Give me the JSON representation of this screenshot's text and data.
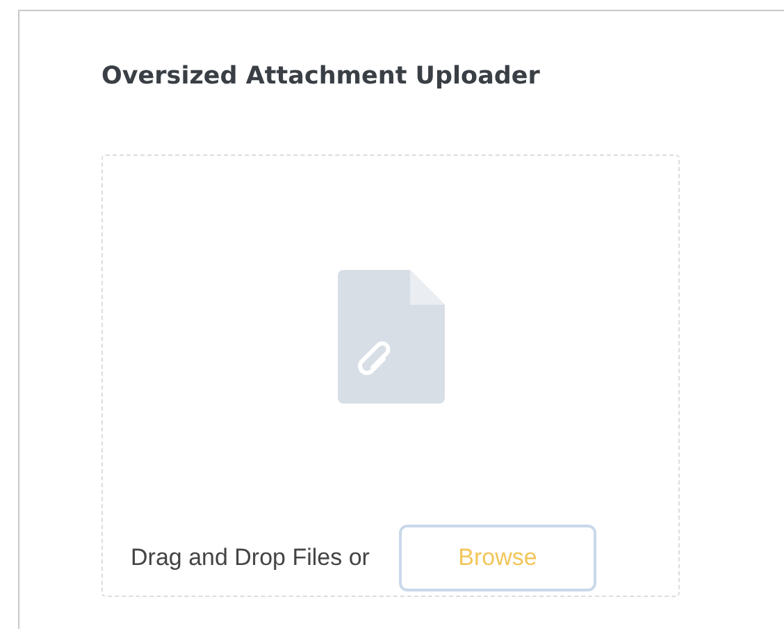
{
  "card": {
    "title": "Oversized Attachment Uploader"
  },
  "dropzone": {
    "prompt": "Drag and Drop Files or",
    "button": "Browse"
  }
}
